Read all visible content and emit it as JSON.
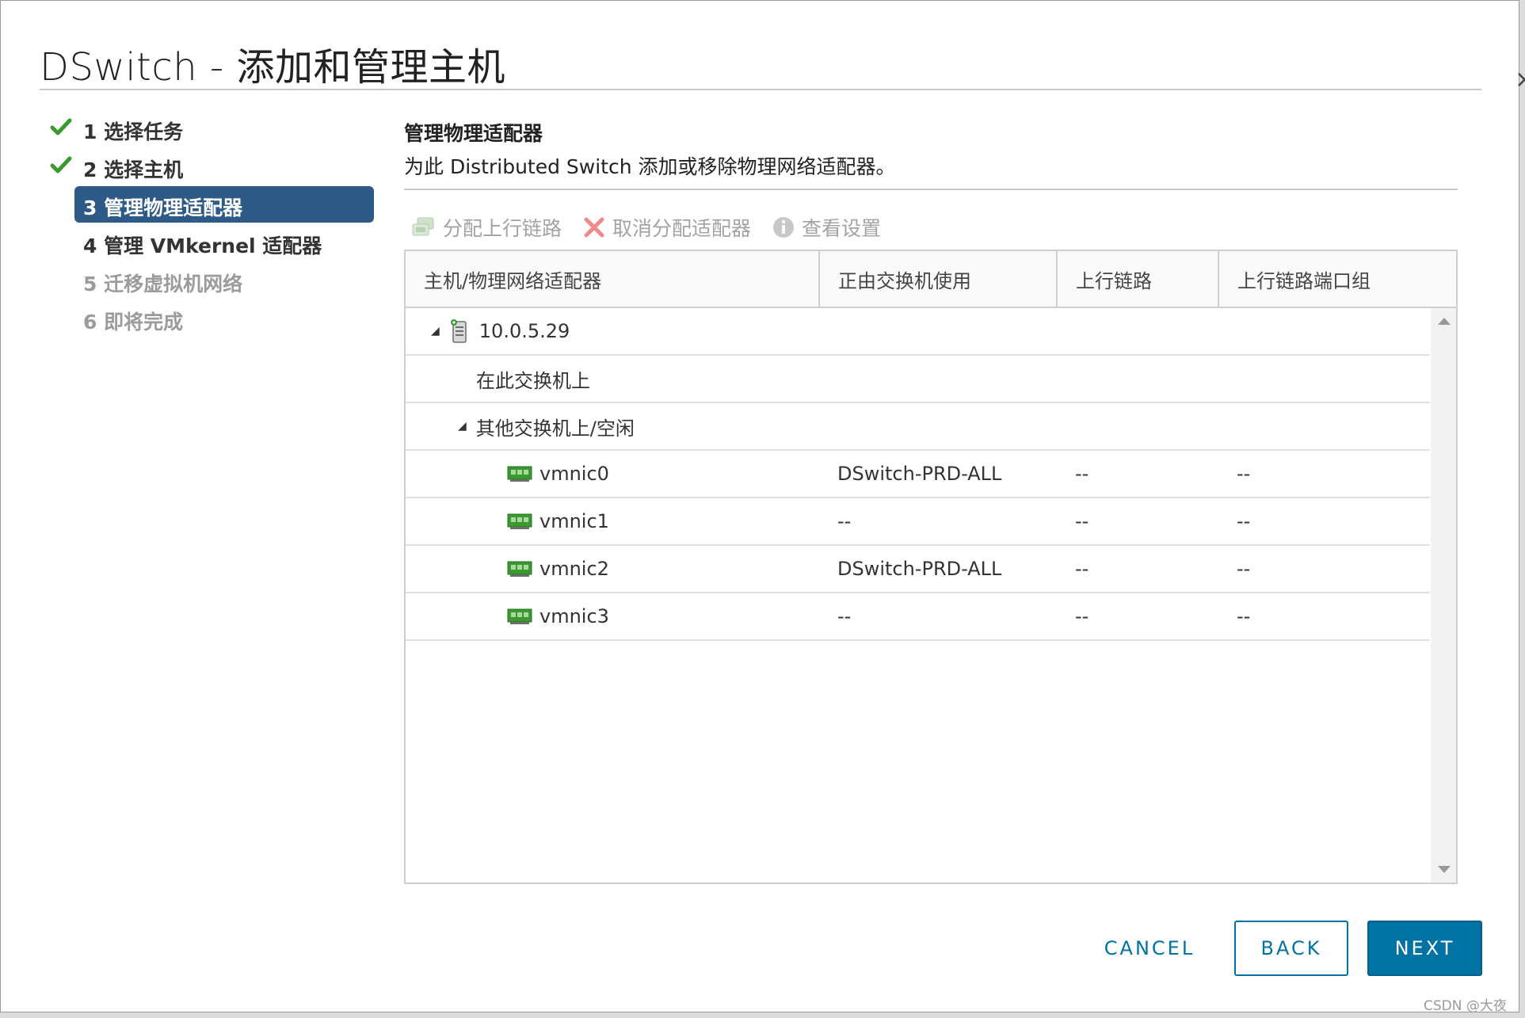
{
  "dialog": {
    "title": "DSwitch - 添加和管理主机",
    "close_glyph": "×"
  },
  "steps": [
    {
      "label": "1 选择任务",
      "state": "done"
    },
    {
      "label": "2 选择主机",
      "state": "done"
    },
    {
      "label": "3 管理物理适配器",
      "state": "active"
    },
    {
      "label": "4 管理 VMkernel 适配器",
      "state": "normal"
    },
    {
      "label": "5 迁移虚拟机网络",
      "state": "pending"
    },
    {
      "label": "6 即将完成",
      "state": "pending"
    }
  ],
  "section": {
    "title": "管理物理适配器",
    "description": "为此 Distributed Switch 添加或移除物理网络适配器。"
  },
  "toolbar": {
    "assign_uplink": "分配上行链路",
    "unassign_adapter": "取消分配适配器",
    "view_settings": "查看设置"
  },
  "table": {
    "columns": [
      "主机/物理网络适配器",
      "正由交换机使用",
      "上行链路",
      "上行链路端口组"
    ],
    "host": {
      "name": "10.0.5.29",
      "caret": "◢"
    },
    "group_on_switch": "在此交换机上",
    "group_other": {
      "label": "其他交换机上/空闲",
      "caret": "◢"
    },
    "adapters": [
      {
        "name": "vmnic0",
        "switch": "DSwitch-PRD-ALL",
        "uplink": "--",
        "portgroup": "--"
      },
      {
        "name": "vmnic1",
        "switch": "--",
        "uplink": "--",
        "portgroup": "--"
      },
      {
        "name": "vmnic2",
        "switch": "DSwitch-PRD-ALL",
        "uplink": "--",
        "portgroup": "--"
      },
      {
        "name": "vmnic3",
        "switch": "--",
        "uplink": "--",
        "portgroup": "--"
      }
    ]
  },
  "buttons": {
    "cancel": "CANCEL",
    "back": "BACK",
    "next": "NEXT"
  },
  "watermark": "CSDN @大夜",
  "colors": {
    "accent": "#0072a3",
    "active_step": "#2e5a87",
    "check_green": "#3a9a2f",
    "disabled_text": "#a3a3a3"
  }
}
